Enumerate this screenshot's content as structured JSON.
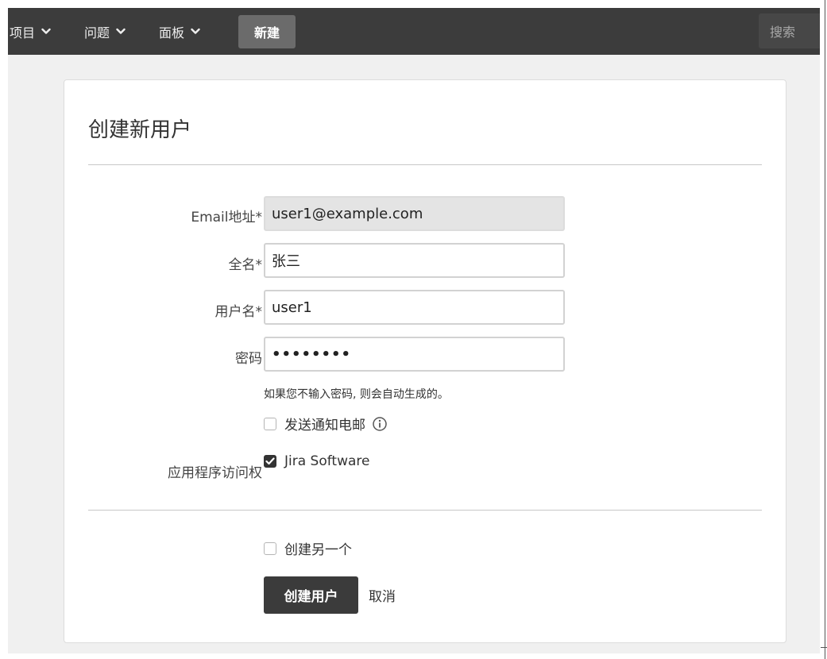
{
  "navbar": {
    "items": [
      {
        "label": "项目"
      },
      {
        "label": "问题"
      },
      {
        "label": "面板"
      }
    ],
    "create_label": "新建",
    "search_label": "搜索"
  },
  "page": {
    "title": "创建新用户"
  },
  "form": {
    "email": {
      "label": "Email地址*",
      "value": "user1@example.com"
    },
    "fullname": {
      "label": "全名*",
      "value": "张三"
    },
    "username": {
      "label": "用户名*",
      "value": "user1"
    },
    "password": {
      "label": "密码",
      "value": "••••••••",
      "hint": "如果您不输入密码, 则会自动生成的。"
    },
    "notify": {
      "label": "发送通知电邮",
      "checked": false
    },
    "app_access": {
      "label": "应用程序访问权",
      "option": "Jira Software",
      "checked": true
    },
    "create_another": {
      "label": "创建另一个",
      "checked": false
    },
    "submit_label": "创建用户",
    "cancel_label": "取消"
  },
  "icons": {
    "nav_chevron": "chevron-down-icon",
    "info": "info-icon",
    "check": "checkmark-icon"
  },
  "colors": {
    "navbar_bg": "#3c3c3c",
    "primary_button": "#3b3b3b",
    "page_bg": "#f0f0f0"
  }
}
